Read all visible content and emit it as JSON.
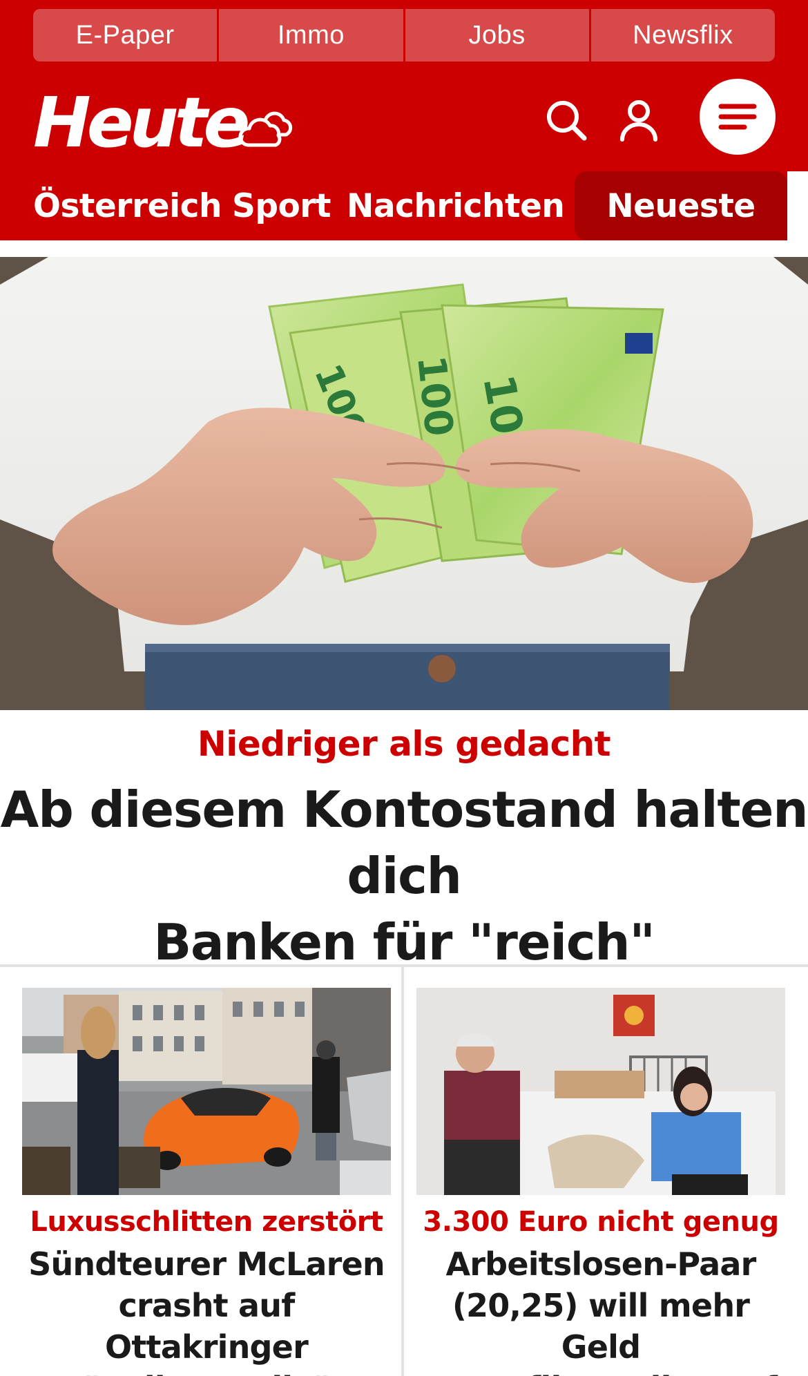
{
  "top_links": [
    "E-Paper",
    "Immo",
    "Jobs",
    "Newsflix"
  ],
  "brand": {
    "logo_text": "Heute",
    "weather_icon": "cloud-sun-icon"
  },
  "header_actions": {
    "search_icon": "search-icon",
    "user_icon": "user-icon",
    "menu_icon": "menu-icon"
  },
  "nav": {
    "items": [
      "Österreich",
      "Sport",
      "Nachrichten"
    ],
    "active": "Neueste"
  },
  "hero": {
    "kicker": "Niedriger als gedacht",
    "title_line1": "Ab diesem Kontostand halten dich",
    "title_line2": "Banken für \"reich\""
  },
  "cards": [
    {
      "kicker": "Luxusschlitten zerstört",
      "title_lines": [
        "Sündteurer McLaren",
        "crasht auf Ottakringer",
        "\"Balkanmeile\""
      ]
    },
    {
      "kicker": "3.300 Euro nicht genug",
      "title_lines": [
        "Arbeitslosen-Paar",
        "(20,25) will mehr Geld",
        "– nun fliegt alles auf"
      ]
    }
  ],
  "colors": {
    "brand_red": "#cc0000",
    "active_tab": "#a60000",
    "toplink_bg": "#d84a4a"
  }
}
